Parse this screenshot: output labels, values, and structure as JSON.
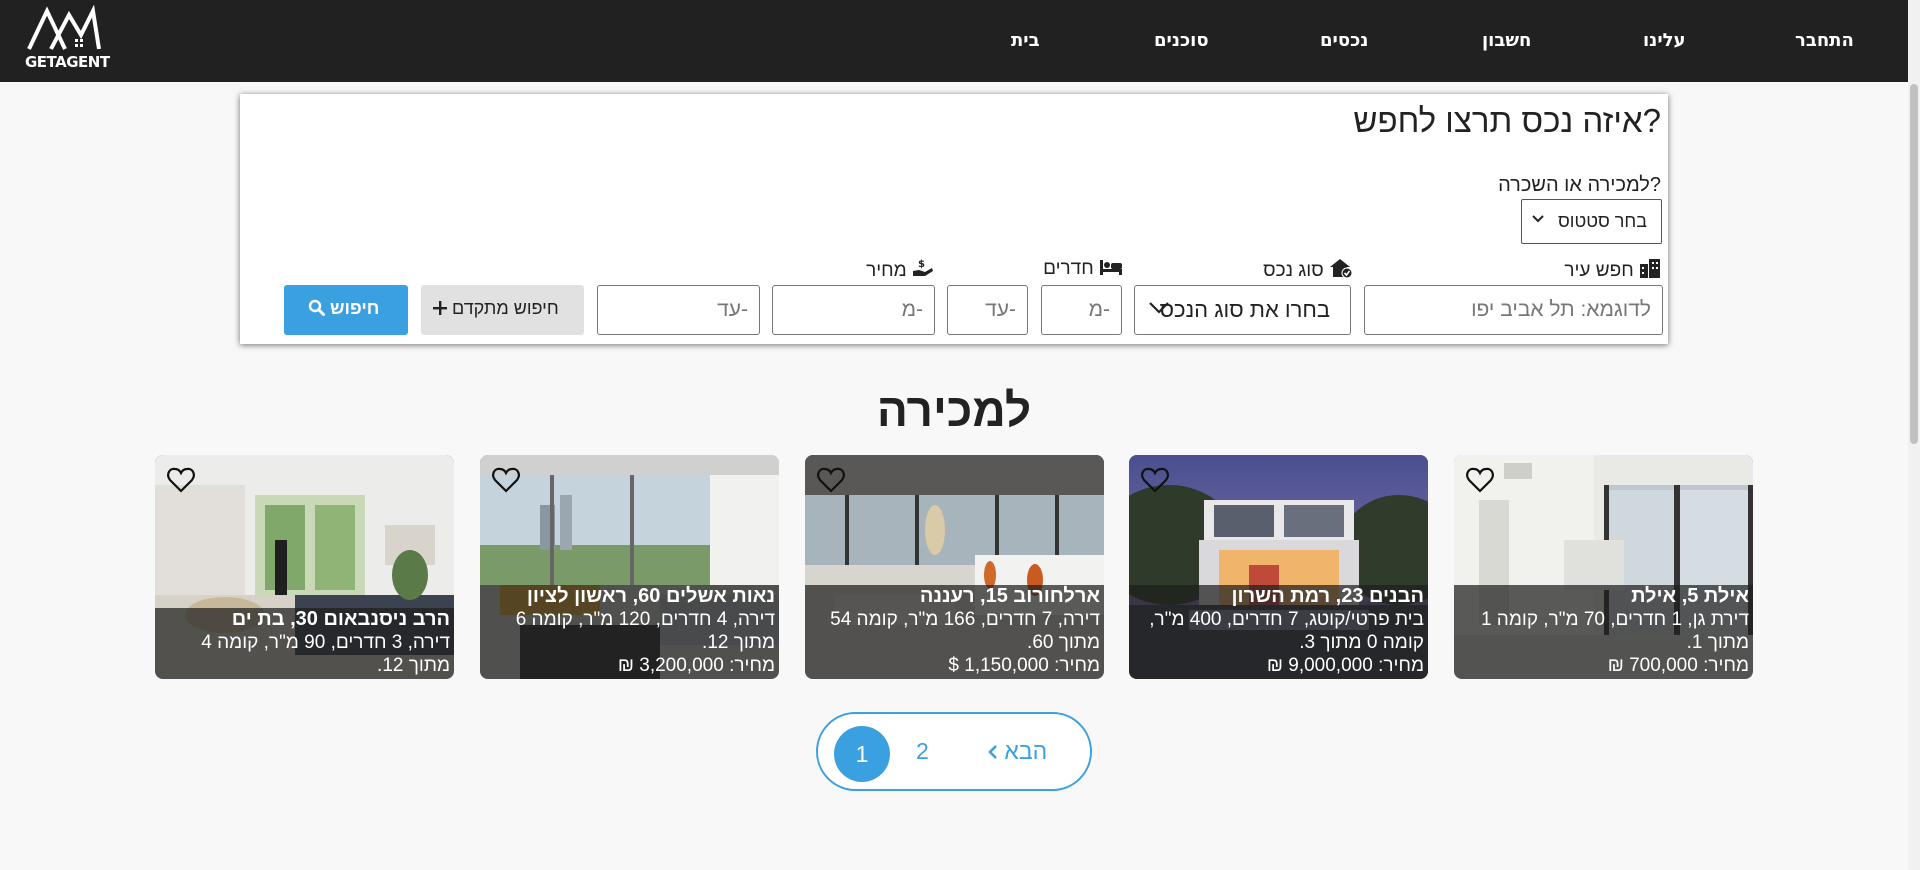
{
  "brand": {
    "name": "GETAGENT"
  },
  "nav": {
    "login": "התחבר",
    "about": "עלינו",
    "account": "חשבון",
    "properties": "נכסים",
    "agents": "סוכנים",
    "home": "בית"
  },
  "search": {
    "title": "איזה נכס תרצו לחפש?",
    "status_label": "למכירה או השכרה?",
    "status_value": "בחר סטטוס",
    "city_label": "חפש עיר",
    "city_placeholder": "לדוגמא: תל אביב יפו",
    "type_label": "סוג נכס",
    "type_value": "בחרו את סוג הנכס",
    "rooms_label": "חדרים",
    "rooms_from": "מ-",
    "rooms_to": "עד-",
    "price_label": "מחיר",
    "price_from": "מ-",
    "price_to": "עד-",
    "advanced_label": "חיפוש מתקדם",
    "search_label": "חיפוש"
  },
  "listings": {
    "title": "למכירה",
    "items": [
      {
        "address": "אילת 5, אילת",
        "details": "דירת גן, 1 חדרים, 70 מ\"ר, קומה 1 מתוך 1.",
        "price": "מחיר: 700,000 ₪"
      },
      {
        "address": "הבנים 23, רמת השרון",
        "details": "בית פרטי/קוטג, 7 חדרים, 400 מ\"ר, קומה 0 מתוך 3.",
        "price": "מחיר: 9,000,000 ₪"
      },
      {
        "address": "ארלחורוב 15, רעננה",
        "details": "דירה, 7 חדרים, 166 מ\"ר, קומה 54 מתוך 60.",
        "price": "מחיר: 1,150,000 $"
      },
      {
        "address": "נאות אשלים 60, ראשון לציון",
        "details": "דירה, 4 חדרים, 120 מ\"ר, קומה 6 מתוך 12.",
        "price": "מחיר: 3,200,000 ₪"
      },
      {
        "address": "הרב ניסנבאום 30, בת ים",
        "details": "דירה, 3 חדרים, 90 מ\"ר, קומה 4 מתוך 12.",
        "price": ""
      }
    ]
  },
  "pagination": {
    "current": "1",
    "page2": "2",
    "next": "הבא"
  }
}
